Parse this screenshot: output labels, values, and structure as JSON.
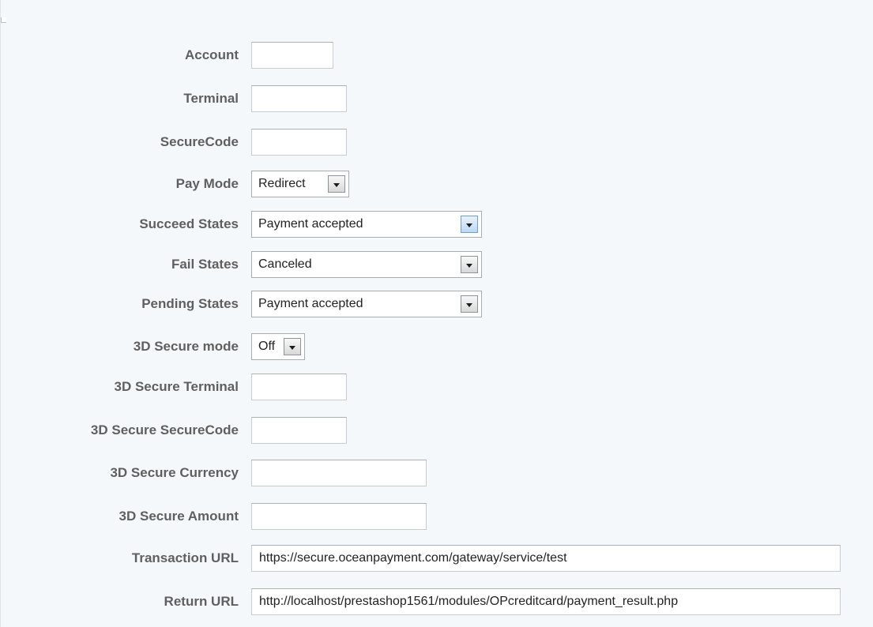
{
  "form": {
    "account": {
      "label": "Account",
      "value": ""
    },
    "terminal": {
      "label": "Terminal",
      "value": ""
    },
    "securecode": {
      "label": "SecureCode",
      "value": ""
    },
    "pay_mode": {
      "label": "Pay Mode",
      "value": "Redirect"
    },
    "succeed_states": {
      "label": "Succeed States",
      "value": "Payment accepted"
    },
    "fail_states": {
      "label": "Fail States",
      "value": "Canceled"
    },
    "pending_states": {
      "label": "Pending States",
      "value": "Payment accepted"
    },
    "secure3d_mode": {
      "label": "3D Secure mode",
      "value": "Off"
    },
    "secure3d_terminal": {
      "label": "3D Secure Terminal",
      "value": ""
    },
    "secure3d_securecode": {
      "label": "3D Secure SecureCode",
      "value": ""
    },
    "secure3d_currency": {
      "label": "3D Secure Currency",
      "value": ""
    },
    "secure3d_amount": {
      "label": "3D Secure Amount",
      "value": ""
    },
    "transaction_url": {
      "label": "Transaction URL",
      "value": "https://secure.oceanpayment.com/gateway/service/test"
    },
    "return_url": {
      "label": "Return URL",
      "value": "http://localhost/prestashop1561/modules/OPcreditcard/payment_result.php"
    }
  },
  "icons": {
    "dropdown_arrow": "chevron-down-icon"
  },
  "colors": {
    "label": "#5f5f5f",
    "panel_bg": "#f5f8fb",
    "focused_select_button": "#bcd7f3"
  }
}
